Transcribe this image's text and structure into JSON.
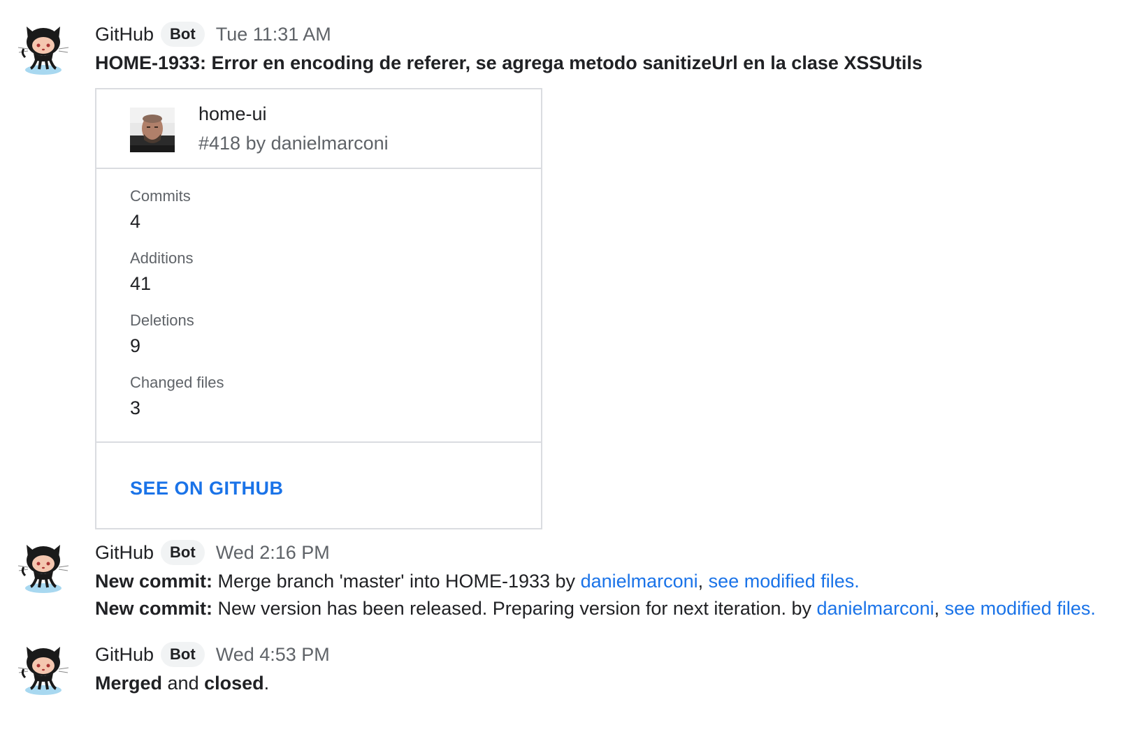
{
  "messages": [
    {
      "sender": "GitHub",
      "badge": "Bot",
      "time": "Tue 11:31 AM",
      "title": "HOME-1933: Error en encoding de referer, se agrega metodo sanitizeUrl en la clase XSSUtils",
      "card": {
        "repo": "home-ui",
        "pr": "#418 by danielmarconi",
        "stats": [
          {
            "label": "Commits",
            "value": "4"
          },
          {
            "label": "Additions",
            "value": "41"
          },
          {
            "label": "Deletions",
            "value": "9"
          },
          {
            "label": "Changed files",
            "value": "3"
          }
        ],
        "action": "SEE ON GITHUB"
      }
    },
    {
      "sender": "GitHub",
      "badge": "Bot",
      "time": "Wed 2:16 PM",
      "commits": [
        {
          "prefix": "New commit:",
          "text": " Merge branch 'master' into HOME-1933 by ",
          "author": "danielmarconi",
          "sep": ", ",
          "link": "see modified files."
        },
        {
          "prefix": "New commit:",
          "text": " New version has been released. Preparing version for next iteration. by ",
          "author": "danielmarconi",
          "sep": ", ",
          "link": "see modified files."
        }
      ]
    },
    {
      "sender": "GitHub",
      "badge": "Bot",
      "time": "Wed 4:53 PM",
      "status": {
        "merged": "Merged",
        "and": " and ",
        "closed": "closed",
        "end": "."
      }
    }
  ],
  "icons": {
    "avatar": "github-octocat-icon",
    "card_photo": "user-photo"
  },
  "colors": {
    "link": "#1a73e8",
    "border": "#dadce0",
    "muted": "#5f6368"
  }
}
